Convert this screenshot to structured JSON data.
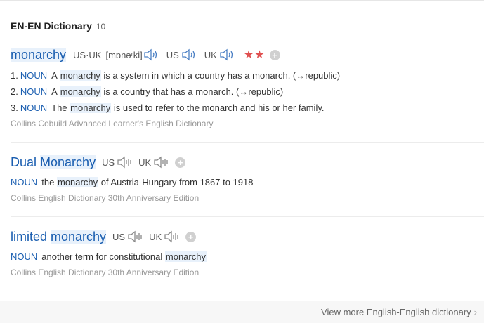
{
  "header": {
    "title": "EN-EN Dictionary",
    "count": "10"
  },
  "entries": [
    {
      "word": "monarchy",
      "us_uk_label": "US·UK",
      "ipa": "[mɒnəʳki]",
      "us_label": "US",
      "uk_label": "UK",
      "stars": "★★",
      "senses": [
        {
          "num": "1.",
          "pos": "NOUN",
          "pre": "A",
          "kw": "monarchy",
          "post": "is a system in which a country has a monarch. (↔republic)"
        },
        {
          "num": "2.",
          "pos": "NOUN",
          "pre": "A",
          "kw": "monarchy",
          "post": "is a country that has a monarch. (↔republic)"
        },
        {
          "num": "3.",
          "pos": "NOUN",
          "pre": "The",
          "kw": "monarchy",
          "post": "is used to refer to the monarch and his or her family."
        }
      ],
      "source": "Collins Cobuild Advanced Learner's English Dictionary"
    },
    {
      "word_a": "Dual",
      "word_b": "Monarchy",
      "us_label": "US",
      "uk_label": "UK",
      "sense": {
        "pos": "NOUN",
        "pre": "the",
        "kw": "monarchy",
        "post": "of Austria-Hungary from 1867 to 1918"
      },
      "source": "Collins English Dictionary 30th Anniversary Edition"
    },
    {
      "word_a": "limited",
      "word_b": "monarchy",
      "us_label": "US",
      "uk_label": "UK",
      "sense": {
        "pos": "NOUN",
        "pre": "another term for constitutional",
        "kw": "monarchy",
        "post": ""
      },
      "source": "Collins English Dictionary 30th Anniversary Edition"
    }
  ],
  "footer": {
    "view_more": "View more English-English dictionary"
  },
  "icons": {
    "speaker": "speaker-icon",
    "add": "plus-icon",
    "chevron": "chevron-right-icon"
  },
  "colors": {
    "link": "#1a5eb0",
    "highlight": "#e8f1fb",
    "star": "#e05050"
  }
}
